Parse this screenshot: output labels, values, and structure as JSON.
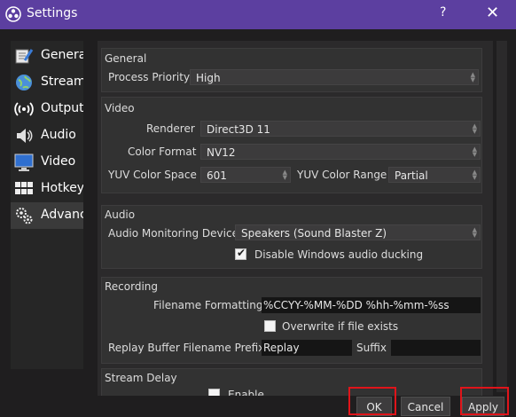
{
  "window": {
    "title": "Settings",
    "help": "?",
    "close": "✕"
  },
  "sidebar": {
    "items": [
      {
        "label": "General",
        "icon": "wrench-icon"
      },
      {
        "label": "Stream",
        "icon": "globe-icon"
      },
      {
        "label": "Output",
        "icon": "signal-icon"
      },
      {
        "label": "Audio",
        "icon": "speaker-icon"
      },
      {
        "label": "Video",
        "icon": "monitor-icon"
      },
      {
        "label": "Hotkeys",
        "icon": "keyboard-icon"
      },
      {
        "label": "Advanced",
        "icon": "gears-icon"
      }
    ],
    "active": "Advanced"
  },
  "general": {
    "title": "General",
    "process_priority_label": "Process Priority",
    "process_priority_value": "High"
  },
  "video": {
    "title": "Video",
    "renderer_label": "Renderer",
    "renderer_value": "Direct3D 11",
    "color_format_label": "Color Format",
    "color_format_value": "NV12",
    "yuv_space_label": "YUV Color Space",
    "yuv_space_value": "601",
    "yuv_range_label": "YUV Color Range",
    "yuv_range_value": "Partial"
  },
  "audio": {
    "title": "Audio",
    "monitoring_label": "Audio Monitoring Device",
    "monitoring_value": "Speakers (Sound Blaster Z)",
    "ducking_label": "Disable Windows audio ducking",
    "ducking_checked": true
  },
  "recording": {
    "title": "Recording",
    "filename_label": "Filename Formatting",
    "filename_value": "%CCYY-%MM-%DD %hh-%mm-%ss",
    "overwrite_label": "Overwrite if file exists",
    "overwrite_checked": false,
    "replay_prefix_label": "Replay Buffer Filename Prefix",
    "replay_prefix_value": "Replay",
    "suffix_label": "Suffix",
    "suffix_value": ""
  },
  "stream_delay": {
    "title": "Stream Delay",
    "enable_label": "Enable"
  },
  "buttons": {
    "ok": "OK",
    "cancel": "Cancel",
    "apply": "Apply"
  },
  "colors": {
    "titlebar": "#5c3fa0",
    "highlight": "#e0141a"
  }
}
